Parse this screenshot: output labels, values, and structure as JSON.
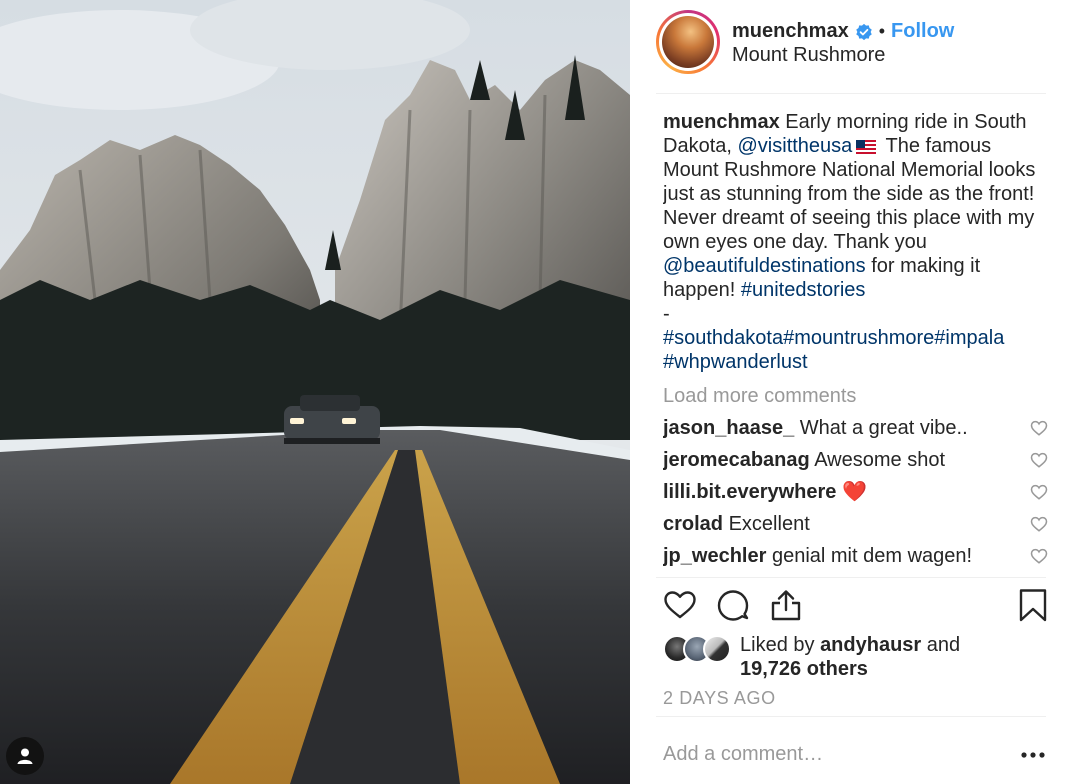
{
  "header": {
    "username": "muenchmax",
    "separator": "•",
    "follow_label": "Follow",
    "location": "Mount Rushmore"
  },
  "caption": {
    "author": "muenchmax",
    "text_1": "Early morning ride in South Dakota,",
    "mention_1": "@visittheusa",
    "flag_icon": "us-flag-emoji",
    "text_2": "The famous Mount Rushmore National Memorial looks just as stunning from the side as the front! Never dreamt of seeing this place with my own eyes one day. Thank you",
    "mention_2": "@beautifuldestinations",
    "text_3": "for making it happen!",
    "hashtag_1": "#unitedstories",
    "dash": "-",
    "hashtag_2": "#southdakota",
    "hashtag_3": "#mountrushmore",
    "hashtag_4": "#impala",
    "hashtag_5": "#whpwanderlust"
  },
  "load_more": "Load more comments",
  "comments": [
    {
      "user": "jason_haase_",
      "text": "What a great vibe.."
    },
    {
      "user": "jeromecabanag",
      "text": "Awesome shot"
    },
    {
      "user": "lilli.bit.everywhere",
      "text": "❤️"
    },
    {
      "user": "crolad",
      "text": "Excellent"
    },
    {
      "user": "jp_wechler",
      "text": "genial mit dem wagen!"
    }
  ],
  "likes": {
    "prefix": "Liked by",
    "user": "andyhausr",
    "middle": "and",
    "others": "19,726 others"
  },
  "timestamp": "2 DAYS AGO",
  "add_comment_placeholder": "Add a comment…",
  "colors": {
    "link": "#003569",
    "follow": "#3897f0",
    "muted": "#999999",
    "verified": "#3897f0"
  },
  "icons": [
    "verified-badge-icon",
    "heart-icon",
    "comment-icon",
    "share-icon",
    "bookmark-icon",
    "more-options-icon",
    "user-tag-icon"
  ]
}
